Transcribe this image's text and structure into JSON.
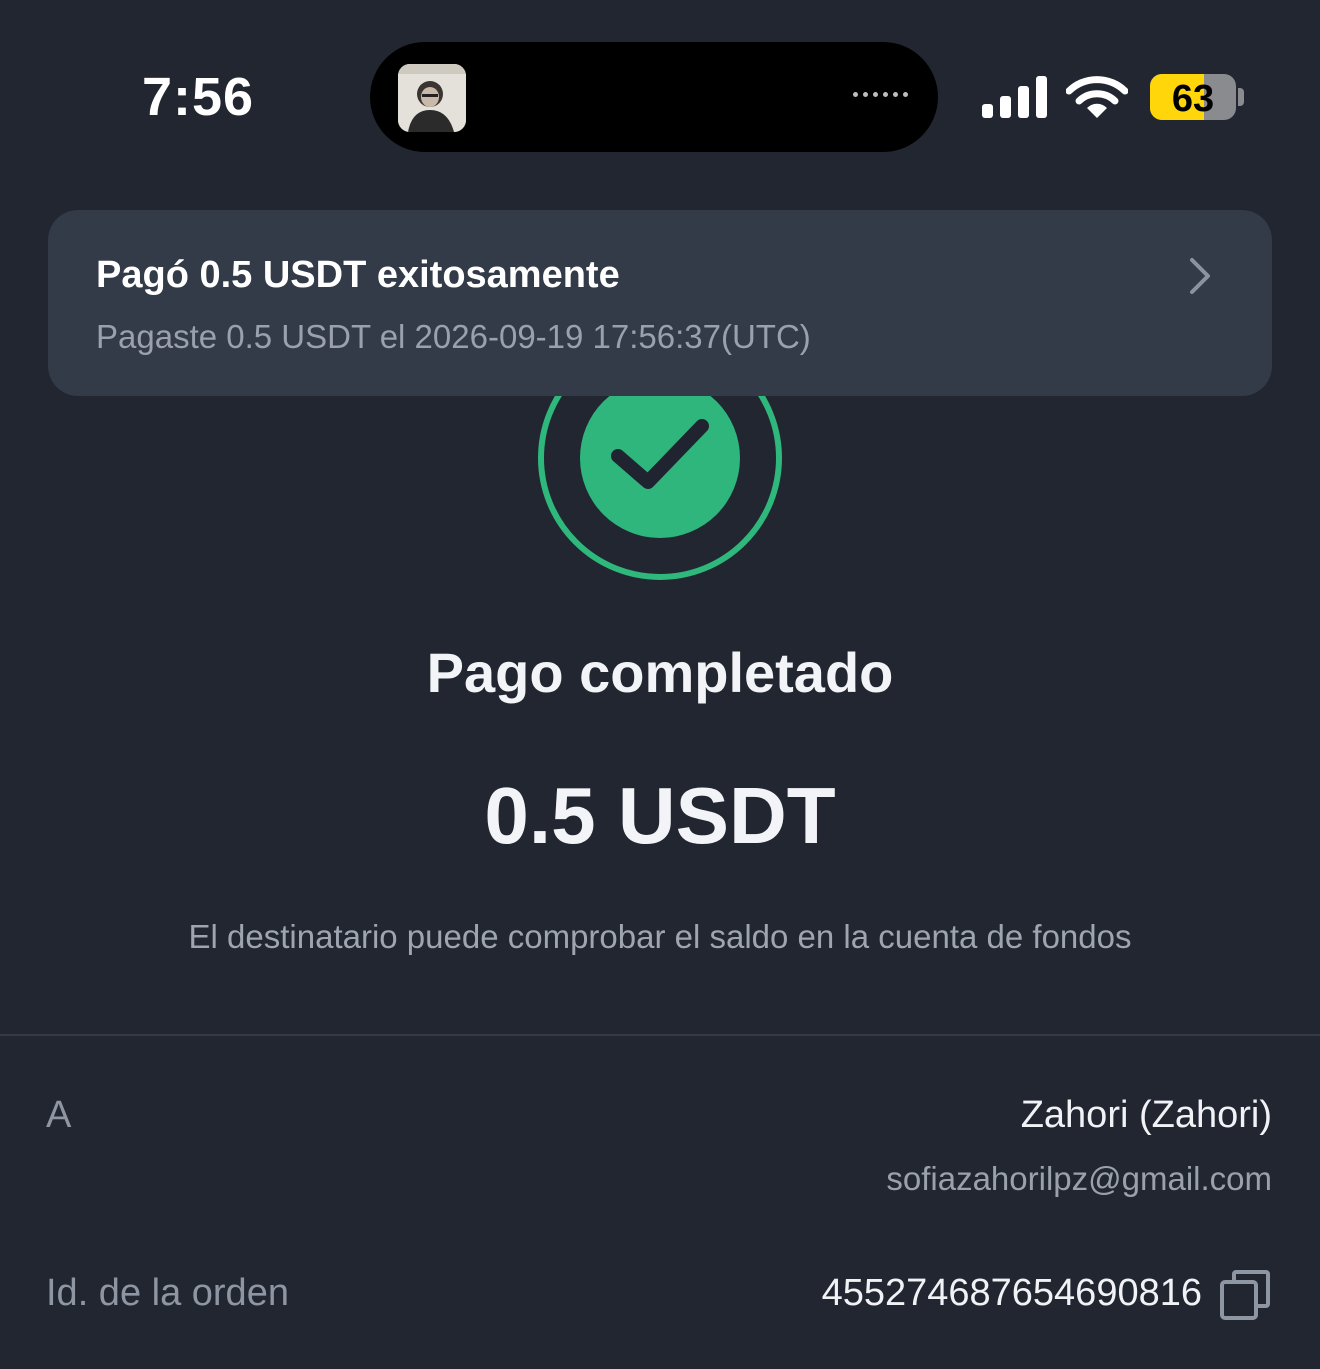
{
  "status_bar": {
    "time": "7:56",
    "battery_level": "63",
    "battery_fraction": 0.63,
    "icons": [
      "signal-icon",
      "wifi-icon",
      "battery-icon"
    ]
  },
  "notification": {
    "title": "Pagó 0.5 USDT exitosamente",
    "subtitle": "Pagaste 0.5 USDT el 2026-09-19 17:56:37(UTC)"
  },
  "result": {
    "title": "Pago completado",
    "amount": "0.5 USDT",
    "note": "El destinatario puede comprobar el saldo en la cuenta de fondos"
  },
  "details": {
    "recipient_label": "A",
    "recipient_name": "Zahori (Zahori)",
    "recipient_email": "sofiazahorilpz@gmail.com",
    "order_label": "Id. de la orden",
    "order_id": "455274687654690816"
  },
  "colors": {
    "background": "#212631",
    "success": "#2eb67c",
    "banner": "#333a48",
    "battery": "#ffd60a"
  }
}
